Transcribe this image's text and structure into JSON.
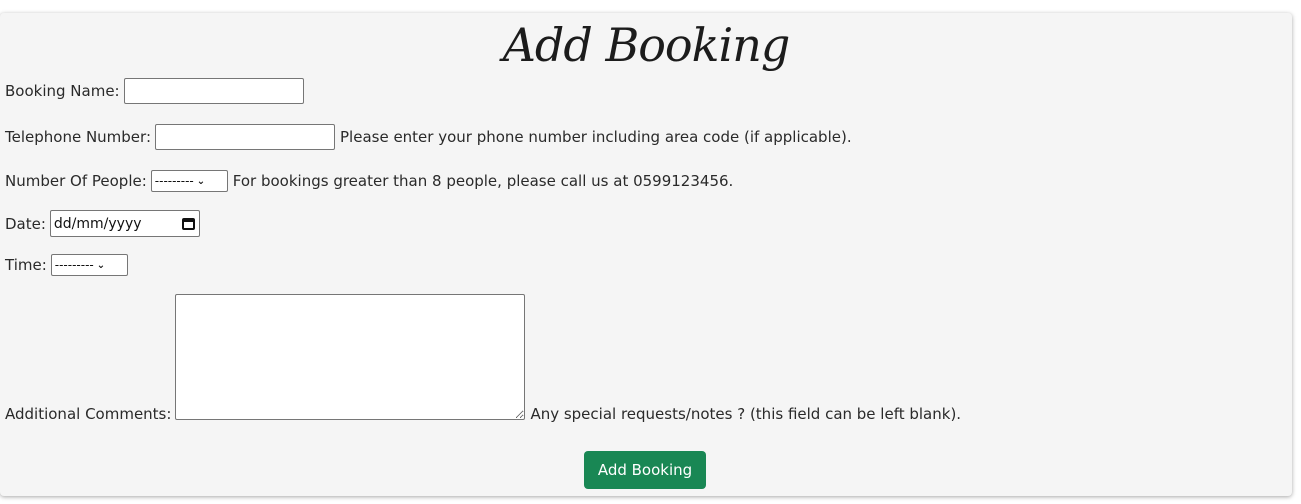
{
  "form": {
    "title": "Add Booking",
    "booking_name": {
      "label": "Booking Name:",
      "value": ""
    },
    "telephone": {
      "label": "Telephone Number:",
      "value": "",
      "help": "Please enter your phone number including area code (if applicable)."
    },
    "people": {
      "label": "Number Of People:",
      "selected": "---------",
      "help": "For bookings greater than 8 people, please call us at 0599123456."
    },
    "date": {
      "label": "Date:",
      "placeholder": "dd/mm/yyyy"
    },
    "time": {
      "label": "Time:",
      "selected": "---------"
    },
    "comments": {
      "label": "Additional Comments:",
      "value": "",
      "help": "Any special requests/notes ? (this field can be left blank)."
    },
    "submit_label": "Add Booking"
  },
  "colors": {
    "submit_bg": "#198754",
    "card_bg": "#f5f5f5"
  },
  "icons": {
    "date_picker": "calendar-icon",
    "select_arrow": "chevron-down-icon"
  }
}
